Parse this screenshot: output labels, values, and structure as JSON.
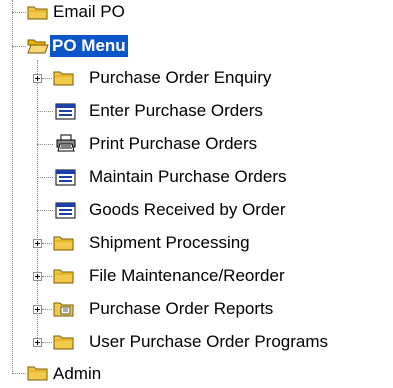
{
  "tree": {
    "email_po": "Email PO",
    "po_menu": "PO Menu",
    "children": [
      {
        "label": "Purchase Order Enquiry",
        "icon": "folder-icon",
        "expandable": true
      },
      {
        "label": "Enter Purchase Orders",
        "icon": "form-window-icon",
        "expandable": false
      },
      {
        "label": "Print Purchase Orders",
        "icon": "printer-icon",
        "expandable": false
      },
      {
        "label": "Maintain Purchase Orders",
        "icon": "form-window-icon",
        "expandable": false
      },
      {
        "label": "Goods Received by Order",
        "icon": "form-window-icon",
        "expandable": false
      },
      {
        "label": "Shipment Processing",
        "icon": "folder-icon",
        "expandable": true
      },
      {
        "label": "File Maintenance/Reorder",
        "icon": "folder-icon",
        "expandable": true
      },
      {
        "label": "Purchase Order Reports",
        "icon": "report-folder-icon",
        "expandable": true
      },
      {
        "label": "User Purchase Order Programs",
        "icon": "folder-icon",
        "expandable": true
      }
    ],
    "admin": "Admin"
  },
  "colors": {
    "selection": "#0a56c9",
    "folder": "#f2c94c"
  }
}
